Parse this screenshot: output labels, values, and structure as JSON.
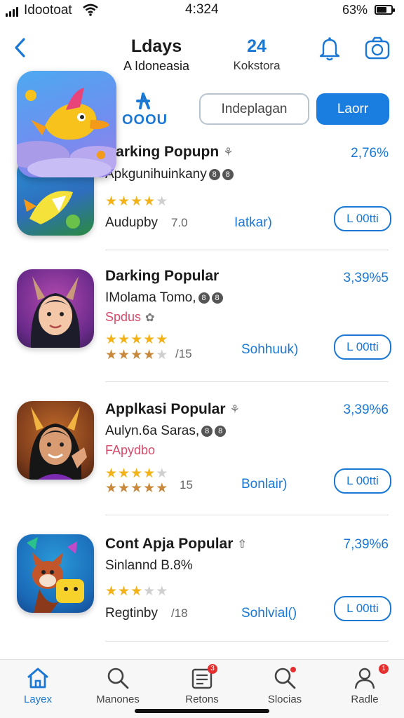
{
  "status": {
    "carrier": "Idootoat",
    "time": "4:324",
    "battery_pct": "63%"
  },
  "header": {
    "title": "Ldays",
    "subtitle": "A Idoneasia",
    "count": "24",
    "count_label": "Kokstora"
  },
  "brand": {
    "logo_text": "OOOU"
  },
  "actions": {
    "secondary_label": "Indeplagan",
    "primary_label": "Laorr"
  },
  "apps": [
    {
      "name": "Darking Popupn",
      "subtitle": "Apkgunihuinkany",
      "tag": "",
      "percent": "2,76%",
      "rating": 4,
      "rating2": null,
      "developer": "Audupby",
      "score": "7.0",
      "link": "Iatkar)",
      "get_label": "L 00tti"
    },
    {
      "name": "Darking Popular",
      "subtitle": "IMolama Tomo,",
      "tag": "Spdus",
      "percent": "3,39%5",
      "rating": 4.5,
      "rating2": 3.5,
      "developer": "",
      "score": "/15",
      "link": "Sohhuuk)",
      "get_label": "L 00tti"
    },
    {
      "name": "Applkasi Popular",
      "subtitle": "Aulyn.6a Saras,",
      "tag": "FApydbo",
      "percent": "3,39%6",
      "rating": 3.5,
      "rating2": 5,
      "developer": "",
      "score": "15",
      "link": "Bonlair)",
      "get_label": "L 00tti"
    },
    {
      "name": "Cont Apja Popular",
      "subtitle": "Sinlannd B.8%",
      "tag": "",
      "percent": "7,39%6",
      "rating": 3,
      "rating2": null,
      "developer": "Regtinby",
      "score": "/18",
      "link": "Sohlvial()",
      "get_label": "L 00tti"
    }
  ],
  "tabbar": {
    "tabs": [
      {
        "label": "Layex",
        "badge": ""
      },
      {
        "label": "Manones",
        "badge": ""
      },
      {
        "label": "Retons",
        "badge": "3"
      },
      {
        "label": "Slocias",
        "badge": ""
      },
      {
        "label": "Radle",
        "badge": "1"
      }
    ]
  },
  "colors": {
    "accent": "#1a78d4",
    "primary_button": "#1a7ee0",
    "star": "#f3b316",
    "tag": "#d84a6a",
    "badge": "#e53030"
  },
  "icons": {
    "back": "chevron-left-icon",
    "bell": "bell-icon",
    "camera": "camera-icon",
    "verified": "verified-icon",
    "share": "share-icon",
    "tab_home": "home-icon",
    "tab_search": "search-icon",
    "tab_news": "news-icon",
    "tab_search2": "search-icon",
    "tab_profile": "user-icon"
  }
}
